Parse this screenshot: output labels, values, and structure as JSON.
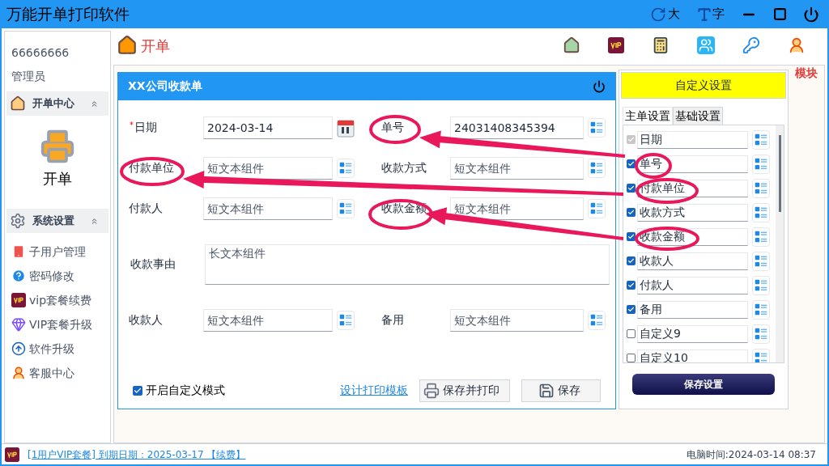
{
  "window": {
    "title": "万能开单打印软件",
    "controls": [
      {
        "kind": "font-size",
        "label": "大"
      },
      {
        "kind": "font-face",
        "label": "字"
      },
      {
        "kind": "minimize"
      },
      {
        "kind": "maximize"
      },
      {
        "kind": "power"
      }
    ]
  },
  "sidebar": {
    "account": "66666666",
    "role": "管理员",
    "sections": [
      {
        "title": "开单中心",
        "kind": "big",
        "expanded": true,
        "items": [
          {
            "label": "开单"
          }
        ]
      },
      {
        "title": "系统设置",
        "kind": "list",
        "expanded": true,
        "items": [
          {
            "label": "子用户管理"
          },
          {
            "label": "密码修改"
          },
          {
            "label": "vip套餐续费"
          },
          {
            "label": "VIP套餐升级"
          },
          {
            "label": "软件升级"
          },
          {
            "label": "客服中心"
          }
        ]
      }
    ]
  },
  "header": {
    "title": "开单"
  },
  "background": {
    "module_label": "模块"
  },
  "dialog": {
    "title": "XX公司收款单",
    "rows": [
      [
        {
          "label": "日期",
          "required": true,
          "kind": "date",
          "value": "2024-03-14"
        },
        {
          "label": "单号",
          "required": false,
          "kind": "text",
          "value": "24031408345394"
        }
      ],
      [
        {
          "label": "付款单位",
          "required": false,
          "kind": "text",
          "placeholder": "短文本组件"
        },
        {
          "label": "收款方式",
          "required": false,
          "kind": "text",
          "placeholder": "短文本组件"
        }
      ],
      [
        {
          "label": "付款人",
          "required": false,
          "kind": "text",
          "placeholder": "短文本组件"
        },
        {
          "label": "收款金额",
          "required": false,
          "kind": "text",
          "placeholder": "短文本组件"
        }
      ],
      [
        {
          "label": "收款事由",
          "required": false,
          "kind": "long",
          "placeholder": "长文本组件"
        }
      ],
      [
        {
          "label": "收款人",
          "required": false,
          "kind": "text",
          "placeholder": "短文本组件"
        },
        {
          "label": "备用",
          "required": false,
          "kind": "text",
          "placeholder": "短文本组件"
        }
      ]
    ],
    "custom_mode": {
      "label": "开启自定义模式",
      "checked": true
    },
    "link": "设计打印模板",
    "buttons": [
      {
        "kind": "print",
        "label": "保存并打印"
      },
      {
        "kind": "save",
        "label": "保存"
      }
    ]
  },
  "settings": {
    "title": "自定义设置",
    "tabs": [
      {
        "label": "主单设置",
        "selected": true
      },
      {
        "label": "基础设置",
        "selected": false
      }
    ],
    "items": [
      {
        "label": "日期",
        "checked": true,
        "disabled": true
      },
      {
        "label": "单号",
        "checked": true,
        "disabled": false
      },
      {
        "label": "付款单位",
        "checked": true,
        "disabled": false
      },
      {
        "label": "收款方式",
        "checked": true,
        "disabled": false
      },
      {
        "label": "收款金额",
        "checked": true,
        "disabled": false
      },
      {
        "label": "收款人",
        "checked": true,
        "disabled": false
      },
      {
        "label": "付款人",
        "checked": true,
        "disabled": false
      },
      {
        "label": "备用",
        "checked": true,
        "disabled": false
      },
      {
        "label": "自定义9",
        "checked": false,
        "disabled": false
      },
      {
        "label": "自定义10",
        "checked": false,
        "disabled": false
      }
    ],
    "save_button": "保存设置"
  },
  "status_bar": {
    "subscription": "[1用户VIP套餐] 到期日期：2025-03-17 【续费】",
    "clock": "电脑时间:2024-03-14 08:37"
  }
}
